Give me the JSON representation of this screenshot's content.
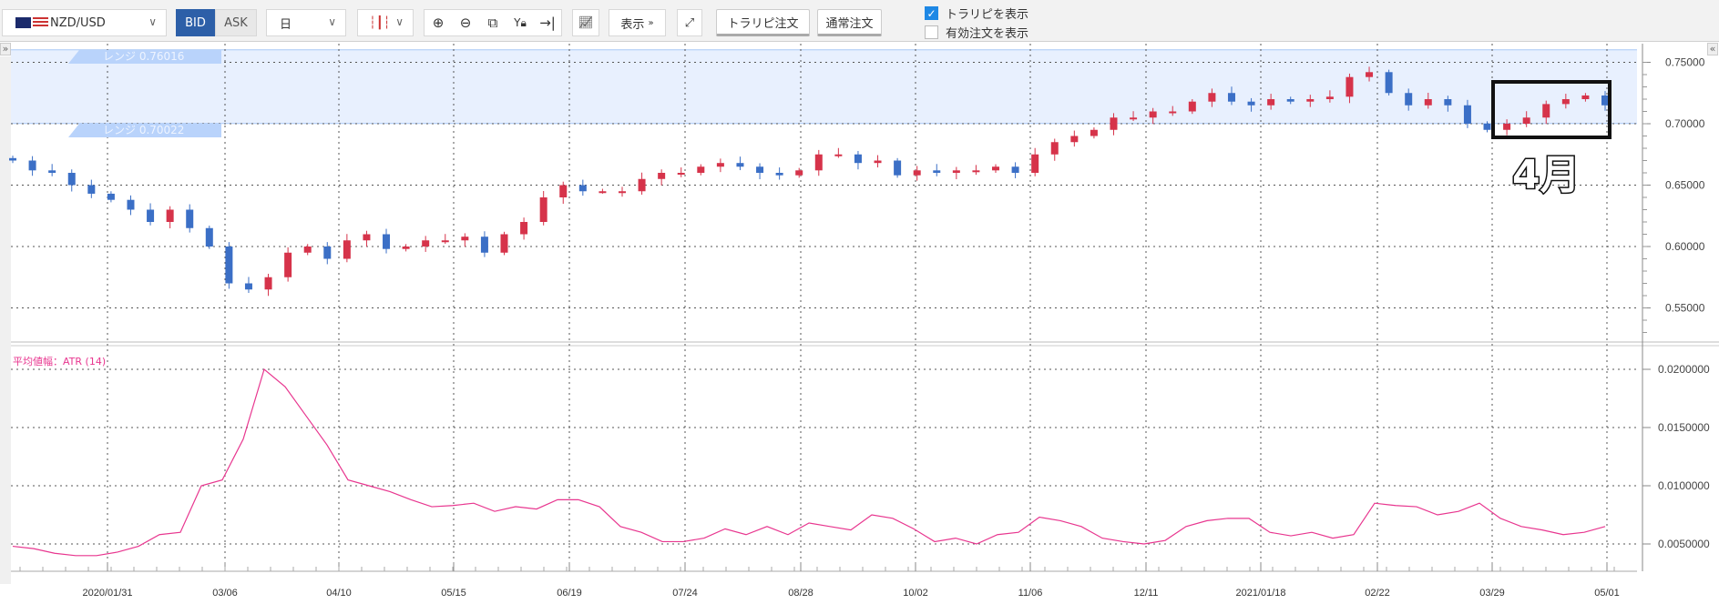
{
  "toolbar": {
    "pair": "NZD/USD",
    "bid": "BID",
    "ask": "ASK",
    "timeframe": "日",
    "display_label": "表示",
    "trarepi_order": "トラリピ注文",
    "normal_order": "通常注文",
    "show_trarepi": "トラリピを表示",
    "show_trarepi_checked": true,
    "show_active_orders": "有効注文を表示",
    "show_active_orders_checked": false
  },
  "range": {
    "upper_label": "レンジ 0.76016",
    "lower_label": "レンジ 0.70022",
    "upper": 0.76016,
    "lower": 0.70022
  },
  "annotation": {
    "text": "4月"
  },
  "atr_label": "平均値幅：ATR (14)",
  "colors": {
    "up": "#d6334a",
    "down": "#3b6fc6",
    "atr": "#e8368f",
    "range_fill": "#e8f0fe"
  },
  "chart_data": [
    {
      "type": "candlestick",
      "title": "NZD/USD",
      "price_ticks": [
        "0.75000",
        "0.70000",
        "0.65000",
        "0.60000",
        "0.55000"
      ],
      "price_tick_values": [
        0.75,
        0.7,
        0.65,
        0.6,
        0.55
      ],
      "ylim": [
        0.52,
        0.765
      ],
      "x_ticks": [
        "2020/01/31",
        "03/06",
        "04/10",
        "05/15",
        "06/19",
        "07/24",
        "08/28",
        "10/02",
        "11/06",
        "12/11",
        "2021/01/18",
        "02/22",
        "03/29",
        "05/01"
      ],
      "closes": [
        0.67,
        0.662,
        0.66,
        0.65,
        0.643,
        0.638,
        0.63,
        0.62,
        0.63,
        0.615,
        0.6,
        0.57,
        0.565,
        0.575,
        0.595,
        0.6,
        0.59,
        0.605,
        0.61,
        0.598,
        0.6,
        0.605,
        0.605,
        0.608,
        0.595,
        0.61,
        0.62,
        0.64,
        0.65,
        0.645,
        0.645,
        0.645,
        0.655,
        0.66,
        0.66,
        0.665,
        0.668,
        0.665,
        0.66,
        0.658,
        0.662,
        0.675,
        0.675,
        0.668,
        0.67,
        0.658,
        0.662,
        0.66,
        0.662,
        0.662,
        0.665,
        0.66,
        0.675,
        0.685,
        0.69,
        0.695,
        0.705,
        0.705,
        0.71,
        0.71,
        0.718,
        0.725,
        0.718,
        0.715,
        0.72,
        0.718,
        0.72,
        0.722,
        0.738,
        0.742,
        0.725,
        0.715,
        0.72,
        0.715,
        0.7,
        0.695,
        0.7,
        0.705,
        0.716,
        0.72,
        0.723,
        0.715
      ]
    },
    {
      "type": "line",
      "title": "平均値幅：ATR (14)",
      "y_ticks": [
        "0.0200000",
        "0.0150000",
        "0.0100000",
        "0.0050000"
      ],
      "y_tick_values": [
        0.02,
        0.015,
        0.01,
        0.005
      ],
      "values": [
        0.0048,
        0.0046,
        0.0042,
        0.004,
        0.004,
        0.0043,
        0.0048,
        0.0058,
        0.006,
        0.01,
        0.0105,
        0.014,
        0.02,
        0.0185,
        0.016,
        0.0135,
        0.0105,
        0.01,
        0.0095,
        0.0088,
        0.0082,
        0.0083,
        0.0085,
        0.0078,
        0.0082,
        0.008,
        0.0088,
        0.0088,
        0.0082,
        0.0065,
        0.006,
        0.0052,
        0.0052,
        0.0055,
        0.0063,
        0.0058,
        0.0065,
        0.0058,
        0.0068,
        0.0065,
        0.0062,
        0.0075,
        0.0072,
        0.0063,
        0.0052,
        0.0055,
        0.005,
        0.0058,
        0.006,
        0.0073,
        0.007,
        0.0065,
        0.0055,
        0.0052,
        0.005,
        0.0053,
        0.0065,
        0.007,
        0.0072,
        0.0072,
        0.006,
        0.0057,
        0.006,
        0.0055,
        0.0058,
        0.0085,
        0.0083,
        0.0082,
        0.0075,
        0.0078,
        0.0085,
        0.0072,
        0.0065,
        0.0062,
        0.0058,
        0.006,
        0.0065
      ]
    }
  ]
}
